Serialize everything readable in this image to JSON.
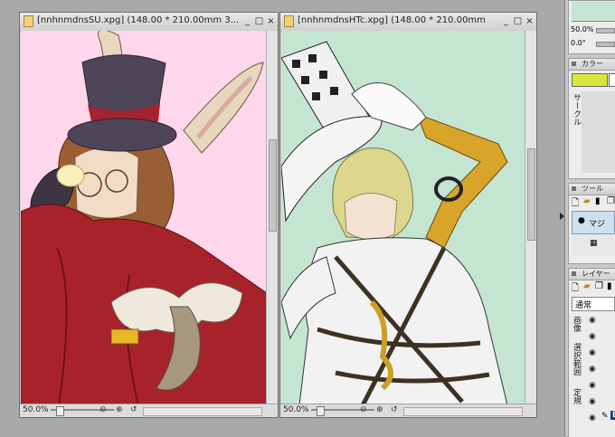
{
  "windows": [
    {
      "title": "[nnhnmdnsSU.xpg] (148.00 * 210.00mm 3...",
      "zoom": "50.0%"
    },
    {
      "title": "[nnhnmdnsHTc.xpg] (148.00 * 210.00mm",
      "zoom": "50.0%"
    }
  ],
  "right_panel": {
    "zoom_value": "50.0%",
    "angle_value": "0.0°",
    "color_header": "カラー",
    "circle_label": "サークル",
    "tool_header": "ツール",
    "tool_item": "マジ",
    "layer_header": "レイヤー",
    "blend_mode": "通常",
    "layer_tabs": [
      "画像",
      "選択範囲",
      "定規"
    ],
    "layer_badge": "L"
  },
  "colors": {
    "canvas_left_bg": "#ffd6ea",
    "canvas_right_bg": "#c4e5d2",
    "main_color": "#d8e63c",
    "sub_color": "#ffffff"
  },
  "icons": [
    "file-icon",
    "minimize-icon",
    "maximize-icon",
    "close-icon",
    "zoom-out-icon",
    "zoom-in-icon",
    "reset-icon",
    "eye-icon",
    "pen-icon"
  ]
}
